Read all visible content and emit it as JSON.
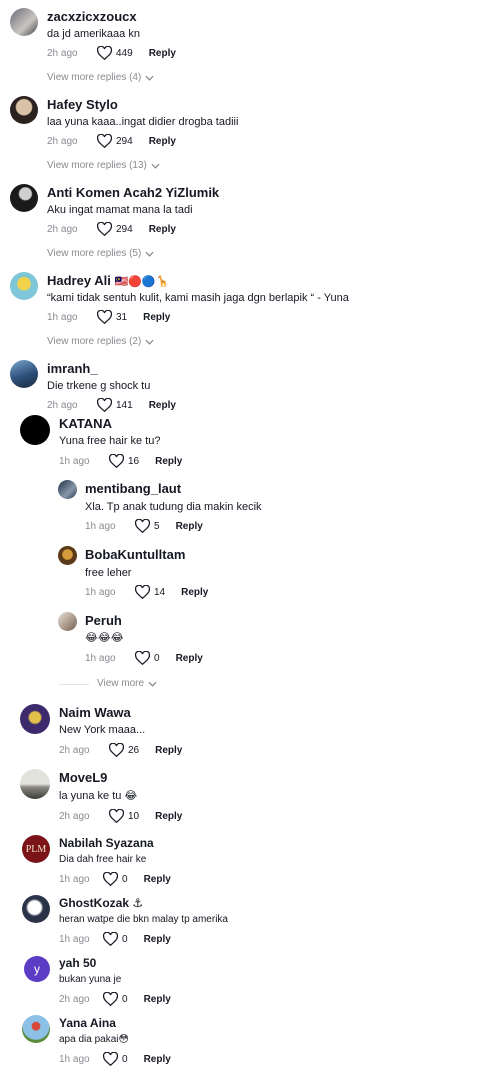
{
  "comments": [
    {
      "user": "zacxzicxzoucx",
      "text": "da jd amerikaaa kn",
      "time": "2h ago",
      "likes": "449",
      "reply": "Reply",
      "more": "View more replies (4)"
    },
    {
      "user": "Hafey Stylo",
      "text": "laa yuna kaaa..ingat didier drogba tadiii",
      "time": "2h ago",
      "likes": "294",
      "reply": "Reply",
      "more": "View more replies (13)"
    },
    {
      "user": "Anti Komen Acah2 YiZlumik",
      "text": "Aku ingat mamat mana la tadi",
      "time": "2h ago",
      "likes": "294",
      "reply": "Reply",
      "more": "View more replies (5)"
    },
    {
      "user": "Hadrey Ali",
      "user_emoji": "🇲🇾🔴🔵🦒",
      "text": "“kami tidak sentuh kulit, kami masih jaga dgn berlapik “ - Yuna",
      "time": "1h ago",
      "likes": "31",
      "reply": "Reply",
      "more": "View more replies (2)"
    },
    {
      "user": "imranh_",
      "text": "Die trkene g shock tu",
      "time": "2h ago",
      "likes": "141",
      "reply": "Reply"
    }
  ],
  "replies": [
    {
      "user": "KATANA",
      "text": "Yuna free hair ke tu?",
      "time": "1h ago",
      "likes": "16",
      "reply": "Reply"
    }
  ],
  "subreplies": [
    {
      "user": "mentibang_laut",
      "text": "Xla. Tp anak tudung dia makin kecik",
      "time": "1h ago",
      "likes": "5",
      "reply": "Reply"
    },
    {
      "user": "BobaKuntulltam",
      "text": "free leher",
      "time": "1h ago",
      "likes": "14",
      "reply": "Reply"
    },
    {
      "user": "Peruh",
      "text": "😂😂😂",
      "time": "1h ago",
      "likes": "0",
      "reply": "Reply"
    }
  ],
  "subreplies_more": "View more",
  "thread2": [
    {
      "user": "Naim Wawa",
      "text": "New York maaa...",
      "time": "2h ago",
      "likes": "26",
      "reply": "Reply"
    },
    {
      "user": "MoveL9",
      "text": "la yuna ke tu 😂",
      "time": "2h ago",
      "likes": "10",
      "reply": "Reply"
    },
    {
      "user": "Nabilah Syazana",
      "text": "Dia dah free hair ke",
      "time": "1h ago",
      "likes": "0",
      "reply": "Reply",
      "avatar_text": "PLM"
    },
    {
      "user": "GhostKozak ⚓",
      "text": "heran watpe die bkn malay tp amerika",
      "time": "1h ago",
      "likes": "0",
      "reply": "Reply"
    },
    {
      "user": "yah 50",
      "text": "bukan yuna je",
      "time": "2h ago",
      "likes": "0",
      "reply": "Reply",
      "avatar_text": "y"
    },
    {
      "user": "Yana Aina",
      "text": "apa dia pakai😳",
      "time": "1h ago",
      "likes": "0",
      "reply": "Reply"
    }
  ],
  "colors": {
    "text": "#161823",
    "muted": "#8a8b91",
    "divider": "#e5e5e8",
    "yah_avatar": "#5b3cc4",
    "plm_avatar": "#7a1418"
  }
}
